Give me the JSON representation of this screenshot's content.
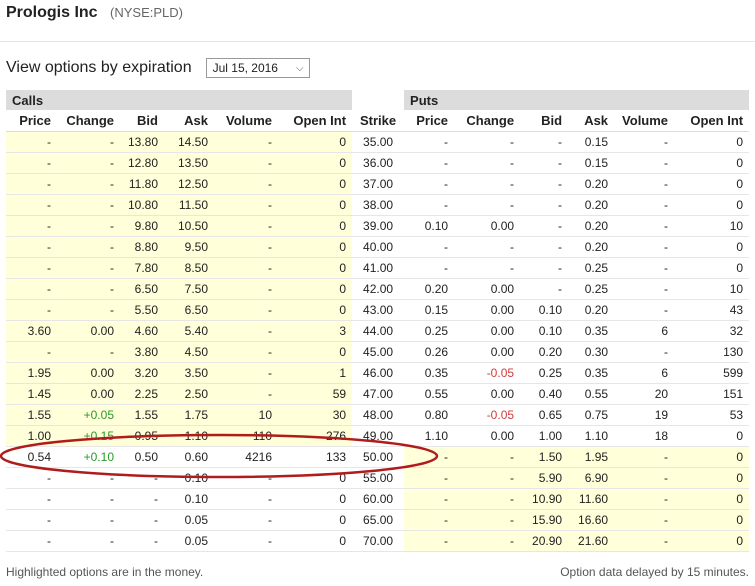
{
  "header": {
    "company": "Prologis Inc",
    "ticker": "(NYSE:PLD)"
  },
  "expiration": {
    "label": "View options by expiration",
    "selected": "Jul 15, 2016"
  },
  "groups": {
    "calls": "Calls",
    "puts": "Puts"
  },
  "columns": [
    "Price",
    "Change",
    "Bid",
    "Ask",
    "Volume",
    "Open Int",
    "Strike",
    "Price",
    "Change",
    "Bid",
    "Ask",
    "Volume",
    "Open Int"
  ],
  "rows": [
    {
      "c": [
        "-",
        "-",
        "13.80",
        "14.50",
        "-",
        "0"
      ],
      "s": "35.00",
      "p": [
        "-",
        "-",
        "-",
        "0.15",
        "-",
        "0"
      ],
      "call_itm": true,
      "put_itm": false
    },
    {
      "c": [
        "-",
        "-",
        "12.80",
        "13.50",
        "-",
        "0"
      ],
      "s": "36.00",
      "p": [
        "-",
        "-",
        "-",
        "0.15",
        "-",
        "0"
      ],
      "call_itm": true,
      "put_itm": false
    },
    {
      "c": [
        "-",
        "-",
        "11.80",
        "12.50",
        "-",
        "0"
      ],
      "s": "37.00",
      "p": [
        "-",
        "-",
        "-",
        "0.20",
        "-",
        "0"
      ],
      "call_itm": true,
      "put_itm": false
    },
    {
      "c": [
        "-",
        "-",
        "10.80",
        "11.50",
        "-",
        "0"
      ],
      "s": "38.00",
      "p": [
        "-",
        "-",
        "-",
        "0.20",
        "-",
        "0"
      ],
      "call_itm": true,
      "put_itm": false
    },
    {
      "c": [
        "-",
        "-",
        "9.80",
        "10.50",
        "-",
        "0"
      ],
      "s": "39.00",
      "p": [
        "0.10",
        "0.00",
        "-",
        "0.20",
        "-",
        "10"
      ],
      "call_itm": true,
      "put_itm": false
    },
    {
      "c": [
        "-",
        "-",
        "8.80",
        "9.50",
        "-",
        "0"
      ],
      "s": "40.00",
      "p": [
        "-",
        "-",
        "-",
        "0.20",
        "-",
        "0"
      ],
      "call_itm": true,
      "put_itm": false
    },
    {
      "c": [
        "-",
        "-",
        "7.80",
        "8.50",
        "-",
        "0"
      ],
      "s": "41.00",
      "p": [
        "-",
        "-",
        "-",
        "0.25",
        "-",
        "0"
      ],
      "call_itm": true,
      "put_itm": false
    },
    {
      "c": [
        "-",
        "-",
        "6.50",
        "7.50",
        "-",
        "0"
      ],
      "s": "42.00",
      "p": [
        "0.20",
        "0.00",
        "-",
        "0.25",
        "-",
        "10"
      ],
      "call_itm": true,
      "put_itm": false
    },
    {
      "c": [
        "-",
        "-",
        "5.50",
        "6.50",
        "-",
        "0"
      ],
      "s": "43.00",
      "p": [
        "0.15",
        "0.00",
        "0.10",
        "0.20",
        "-",
        "43"
      ],
      "call_itm": true,
      "put_itm": false
    },
    {
      "c": [
        "3.60",
        "0.00",
        "4.60",
        "5.40",
        "-",
        "3"
      ],
      "s": "44.00",
      "p": [
        "0.25",
        "0.00",
        "0.10",
        "0.35",
        "6",
        "32"
      ],
      "call_itm": true,
      "put_itm": false
    },
    {
      "c": [
        "-",
        "-",
        "3.80",
        "4.50",
        "-",
        "0"
      ],
      "s": "45.00",
      "p": [
        "0.26",
        "0.00",
        "0.20",
        "0.30",
        "-",
        "130"
      ],
      "call_itm": true,
      "put_itm": false
    },
    {
      "c": [
        "1.95",
        "0.00",
        "3.20",
        "3.50",
        "-",
        "1"
      ],
      "s": "46.00",
      "p": [
        "0.35",
        "-0.05",
        "0.25",
        "0.35",
        "6",
        "599"
      ],
      "call_itm": true,
      "put_itm": false
    },
    {
      "c": [
        "1.45",
        "0.00",
        "2.25",
        "2.50",
        "-",
        "59"
      ],
      "s": "47.00",
      "p": [
        "0.55",
        "0.00",
        "0.40",
        "0.55",
        "20",
        "151"
      ],
      "call_itm": true,
      "put_itm": false
    },
    {
      "c": [
        "1.55",
        "+0.05",
        "1.55",
        "1.75",
        "10",
        "30"
      ],
      "s": "48.00",
      "p": [
        "0.80",
        "-0.05",
        "0.65",
        "0.75",
        "19",
        "53"
      ],
      "call_itm": true,
      "put_itm": false
    },
    {
      "c": [
        "1.00",
        "+0.15",
        "0.95",
        "1.10",
        "110",
        "276"
      ],
      "s": "49.00",
      "p": [
        "1.10",
        "0.00",
        "1.00",
        "1.10",
        "18",
        "0"
      ],
      "call_itm": true,
      "put_itm": false
    },
    {
      "c": [
        "0.54",
        "+0.10",
        "0.50",
        "0.60",
        "4216",
        "133"
      ],
      "s": "50.00",
      "p": [
        "-",
        "-",
        "1.50",
        "1.95",
        "-",
        "0"
      ],
      "call_itm": false,
      "put_itm": true
    },
    {
      "c": [
        "-",
        "-",
        "-",
        "0.10",
        "-",
        "0"
      ],
      "s": "55.00",
      "p": [
        "-",
        "-",
        "5.90",
        "6.90",
        "-",
        "0"
      ],
      "call_itm": false,
      "put_itm": true
    },
    {
      "c": [
        "-",
        "-",
        "-",
        "0.10",
        "-",
        "0"
      ],
      "s": "60.00",
      "p": [
        "-",
        "-",
        "10.90",
        "11.60",
        "-",
        "0"
      ],
      "call_itm": false,
      "put_itm": true
    },
    {
      "c": [
        "-",
        "-",
        "-",
        "0.05",
        "-",
        "0"
      ],
      "s": "65.00",
      "p": [
        "-",
        "-",
        "15.90",
        "16.60",
        "-",
        "0"
      ],
      "call_itm": false,
      "put_itm": true
    },
    {
      "c": [
        "-",
        "-",
        "-",
        "0.05",
        "-",
        "0"
      ],
      "s": "70.00",
      "p": [
        "-",
        "-",
        "20.90",
        "21.60",
        "-",
        "0"
      ],
      "call_itm": false,
      "put_itm": true
    }
  ],
  "footer": {
    "itm_note": "Highlighted options are in the money.",
    "delay_note": "Option data delayed by 15 minutes."
  },
  "colors": {
    "in_the_money": "#ffffd9",
    "header_band": "#dcdcdc",
    "positive": "#2a9a2a",
    "negative": "#d13c3c",
    "annotation": "#b01c1c"
  }
}
